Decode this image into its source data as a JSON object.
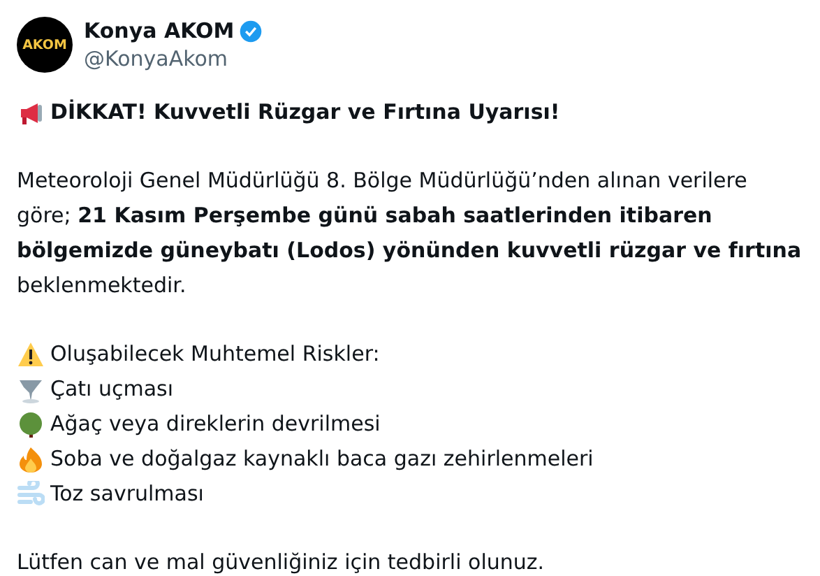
{
  "author": {
    "avatar_text": "AKOM",
    "name": "Konya AKOM",
    "verified": true,
    "handle": "@KonyaAkom"
  },
  "headline": {
    "kind": "megaphone",
    "text": "DİKKAT! Kuvvetli Rüzgar ve Fırtına Uyarısı!"
  },
  "paragraph": "Meteoroloji Genel Müdürlüğü 8. Bölge Müdürlüğü’nden alınan verilere göre; **21 Kasım Perşembe günü sabah saatlerinden itibaren bölgemizde güneybatı (Lodos) yönünden kuvvetli rüzgar ve fırtına** beklenmektedir.",
  "risks": [
    {
      "kind": "warning",
      "text": "Oluşabilecek Muhtemel Riskler:"
    },
    {
      "kind": "tornado",
      "text": "Çatı uçması"
    },
    {
      "kind": "tree",
      "text": "Ağaç veya direklerin devrilmesi"
    },
    {
      "kind": "fire",
      "text": "Soba ve doğalgaz kaynaklı baca gazı zehirlenmeleri"
    },
    {
      "kind": "wind",
      "text": "Toz savrulması"
    }
  ],
  "closing": "Lütfen can ve mal güvenliğiniz için tedbirli olunuz."
}
